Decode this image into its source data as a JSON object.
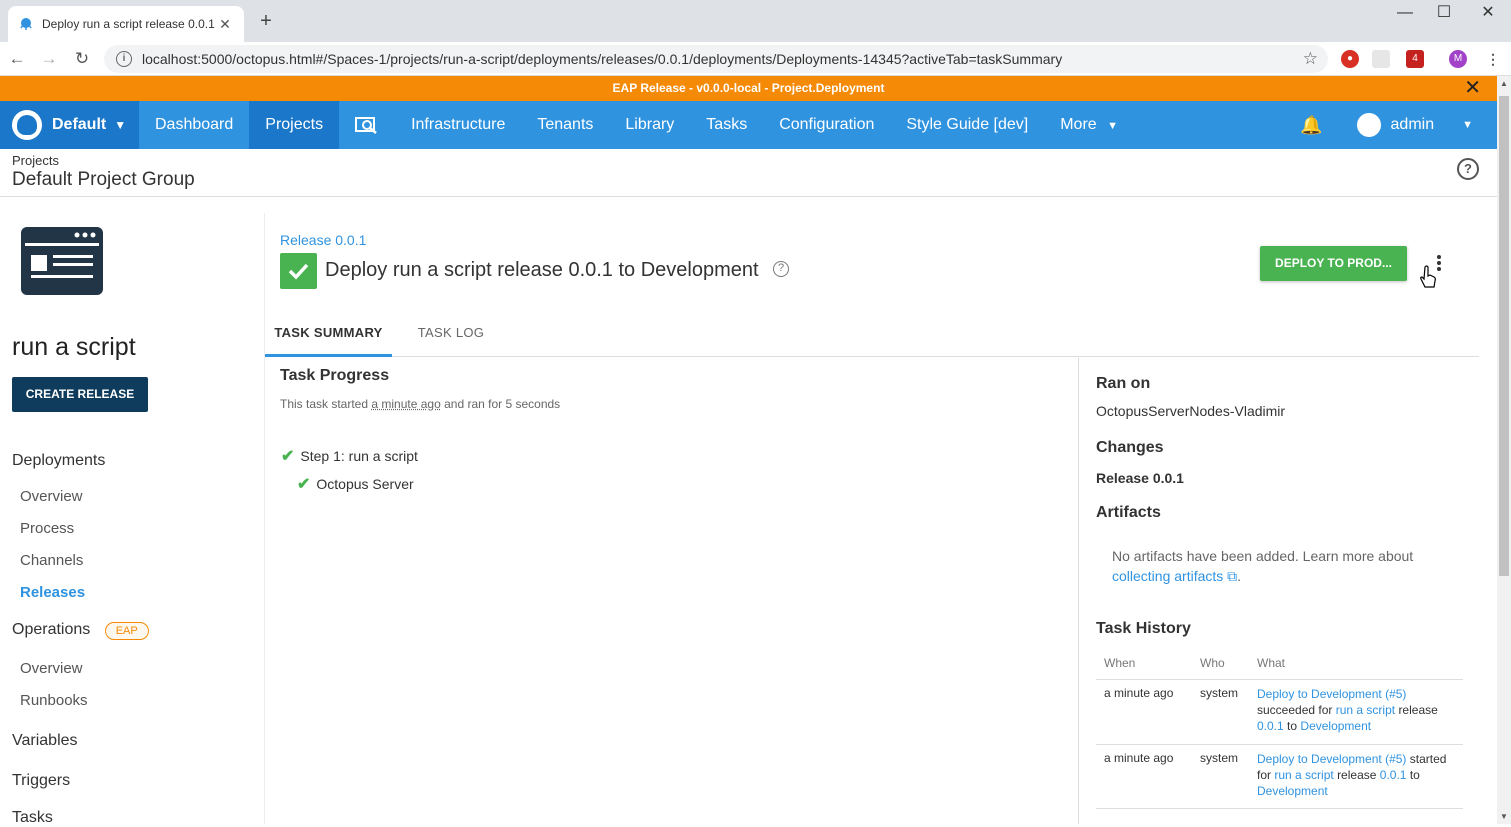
{
  "browser": {
    "tab_title": "Deploy run a script release 0.0.1 t",
    "url": "localhost:5000/octopus.html#/Spaces-1/projects/run-a-script/deployments/releases/0.0.1/deployments/Deployments-14345?activeTab=taskSummary",
    "ext_badge": "4",
    "profile_initial": "M"
  },
  "banner": {
    "text": "EAP Release - v0.0.0-local - Project.Deployment"
  },
  "nav": {
    "space": "Default",
    "items": [
      "Dashboard",
      "Projects",
      "Infrastructure",
      "Tenants",
      "Library",
      "Tasks",
      "Configuration",
      "Style Guide [dev]",
      "More"
    ],
    "user": "admin"
  },
  "header": {
    "breadcrumb": "Projects",
    "title": "Default Project Group"
  },
  "sidebar": {
    "project_name": "run a script",
    "create_release": "CREATE RELEASE",
    "deployments_label": "Deployments",
    "deployments_items": [
      "Overview",
      "Process",
      "Channels",
      "Releases"
    ],
    "operations_label": "Operations",
    "eap_badge": "EAP",
    "operations_items": [
      "Overview",
      "Runbooks"
    ],
    "variables_label": "Variables",
    "triggers_label": "Triggers",
    "tasks_label": "Tasks"
  },
  "main": {
    "release_link": "Release 0.0.1",
    "title": "Deploy run a script release 0.0.1 to Development",
    "deploy_button": "DEPLOY TO PROD...",
    "tabs": [
      "TASK SUMMARY",
      "TASK LOG"
    ],
    "task_progress": {
      "heading": "Task Progress",
      "started_prefix": "This task started",
      "started_when": "a minute ago",
      "started_suffix": "and ran for 5 seconds",
      "step": "Step 1: run a script",
      "substep": "Octopus Server"
    },
    "ran_on": {
      "heading": "Ran on",
      "value": "OctopusServerNodes-Vladimir"
    },
    "changes": {
      "heading": "Changes",
      "value": "Release 0.0.1"
    },
    "artifacts": {
      "heading": "Artifacts",
      "note": "No artifacts have been added. Learn more about",
      "link": "collecting artifacts",
      "tail": "."
    },
    "history": {
      "heading": "Task History",
      "columns": [
        "When",
        "Who",
        "What"
      ],
      "rows": [
        {
          "when": "a minute ago",
          "who": "system",
          "w1": "Deploy to Development (#5)",
          "w2": "succeeded for",
          "w3": "run a script",
          "w4": "release",
          "w5": "0.0.1",
          "w6": "to",
          "w7": "Development"
        },
        {
          "when": "a minute ago",
          "who": "system",
          "w1": "Deploy to Development (#5)",
          "w2": "started for",
          "w3": "run a script",
          "w4": "release",
          "w5": "0.0.1",
          "w6": "to",
          "w7": "Development"
        }
      ]
    }
  }
}
